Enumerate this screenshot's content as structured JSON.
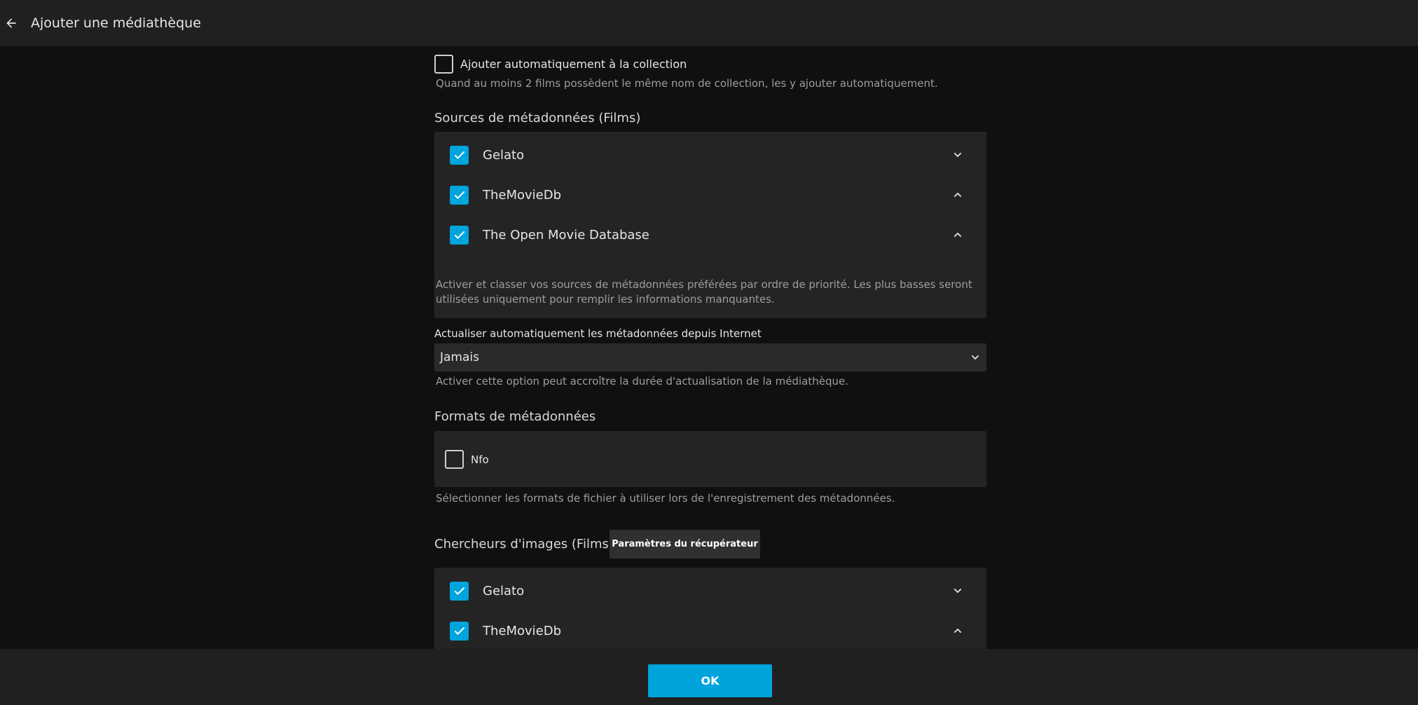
{
  "header": {
    "title": "Ajouter une médiathèque",
    "back_icon": "arrow-left-icon"
  },
  "auto_collection": {
    "label": "Ajouter automatiquement à la collection",
    "checked": false,
    "helper": "Quand au moins 2 films possèdent le même nom de collection, les y ajouter automatiquement."
  },
  "metadata_sources": {
    "title": "Sources de métadonnées (Films)",
    "items": [
      {
        "label": "Gelato",
        "checked": true,
        "chevron": "chevron-down"
      },
      {
        "label": "TheMovieDb",
        "checked": true,
        "chevron": "chevron-up"
      },
      {
        "label": "The Open Movie Database",
        "checked": true,
        "chevron": "chevron-up"
      }
    ],
    "helper": "Activer et classer vos sources de métadonnées préférées par ordre de priorité. Les plus basses seront utilisées uniquement pour remplir les informations manquantes."
  },
  "refresh": {
    "label": "Actualiser automatiquement les métadonnées depuis Internet",
    "value": "Jamais",
    "helper": "Activer cette option peut accroître la durée d'actualisation de la médiathèque."
  },
  "metadata_formats": {
    "title": "Formats de métadonnées",
    "items": [
      {
        "label": "Nfo",
        "checked": false
      }
    ],
    "helper": "Sélectionner les formats de fichier à utiliser lors de l'enregistrement des métadonnées."
  },
  "image_fetchers": {
    "title": "Chercheurs d'images (Films)",
    "settings_button": "Paramètres du récupérateur",
    "items": [
      {
        "label": "Gelato",
        "checked": true,
        "chevron": "chevron-down"
      },
      {
        "label": "TheMovieDb",
        "checked": true,
        "chevron": "chevron-up"
      }
    ]
  },
  "footer": {
    "ok_label": "OK"
  },
  "colors": {
    "accent": "#00a4dc",
    "background": "#101010",
    "surface": "#242424",
    "header": "#202020"
  }
}
